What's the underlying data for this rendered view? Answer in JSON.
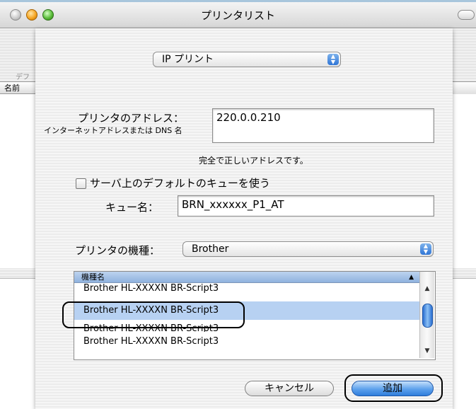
{
  "window": {
    "title": "プリンタリスト",
    "bg_partial_label": "デフ",
    "bg_column_header": "名前"
  },
  "sheet": {
    "connection_popup": "IP プリント",
    "address_label": "プリンタのアドレス：",
    "address_hint": "インターネットアドレスまたは DNS 名",
    "address_value": "220.0.0.210",
    "address_status": "完全で正しいアドレスです。",
    "default_queue_label": "サーバ上のデフォルトのキューを使う",
    "default_queue_checked": false,
    "queue_label": "キュー名：",
    "queue_value": "BRN_xxxxxx_P1_AT",
    "model_label": "プリンタの機種：",
    "model_popup": "Brother",
    "list_header": "機種名",
    "models": [
      "Brother HL-XXXXN BR-Script3",
      "Brother HL-XXXXN BR-Script3",
      "Brother HL-XXXXN BR-Script3",
      "Brother HL-XXXXN BR-Script3"
    ],
    "cancel_label": "キャンセル",
    "add_label": "追加"
  }
}
